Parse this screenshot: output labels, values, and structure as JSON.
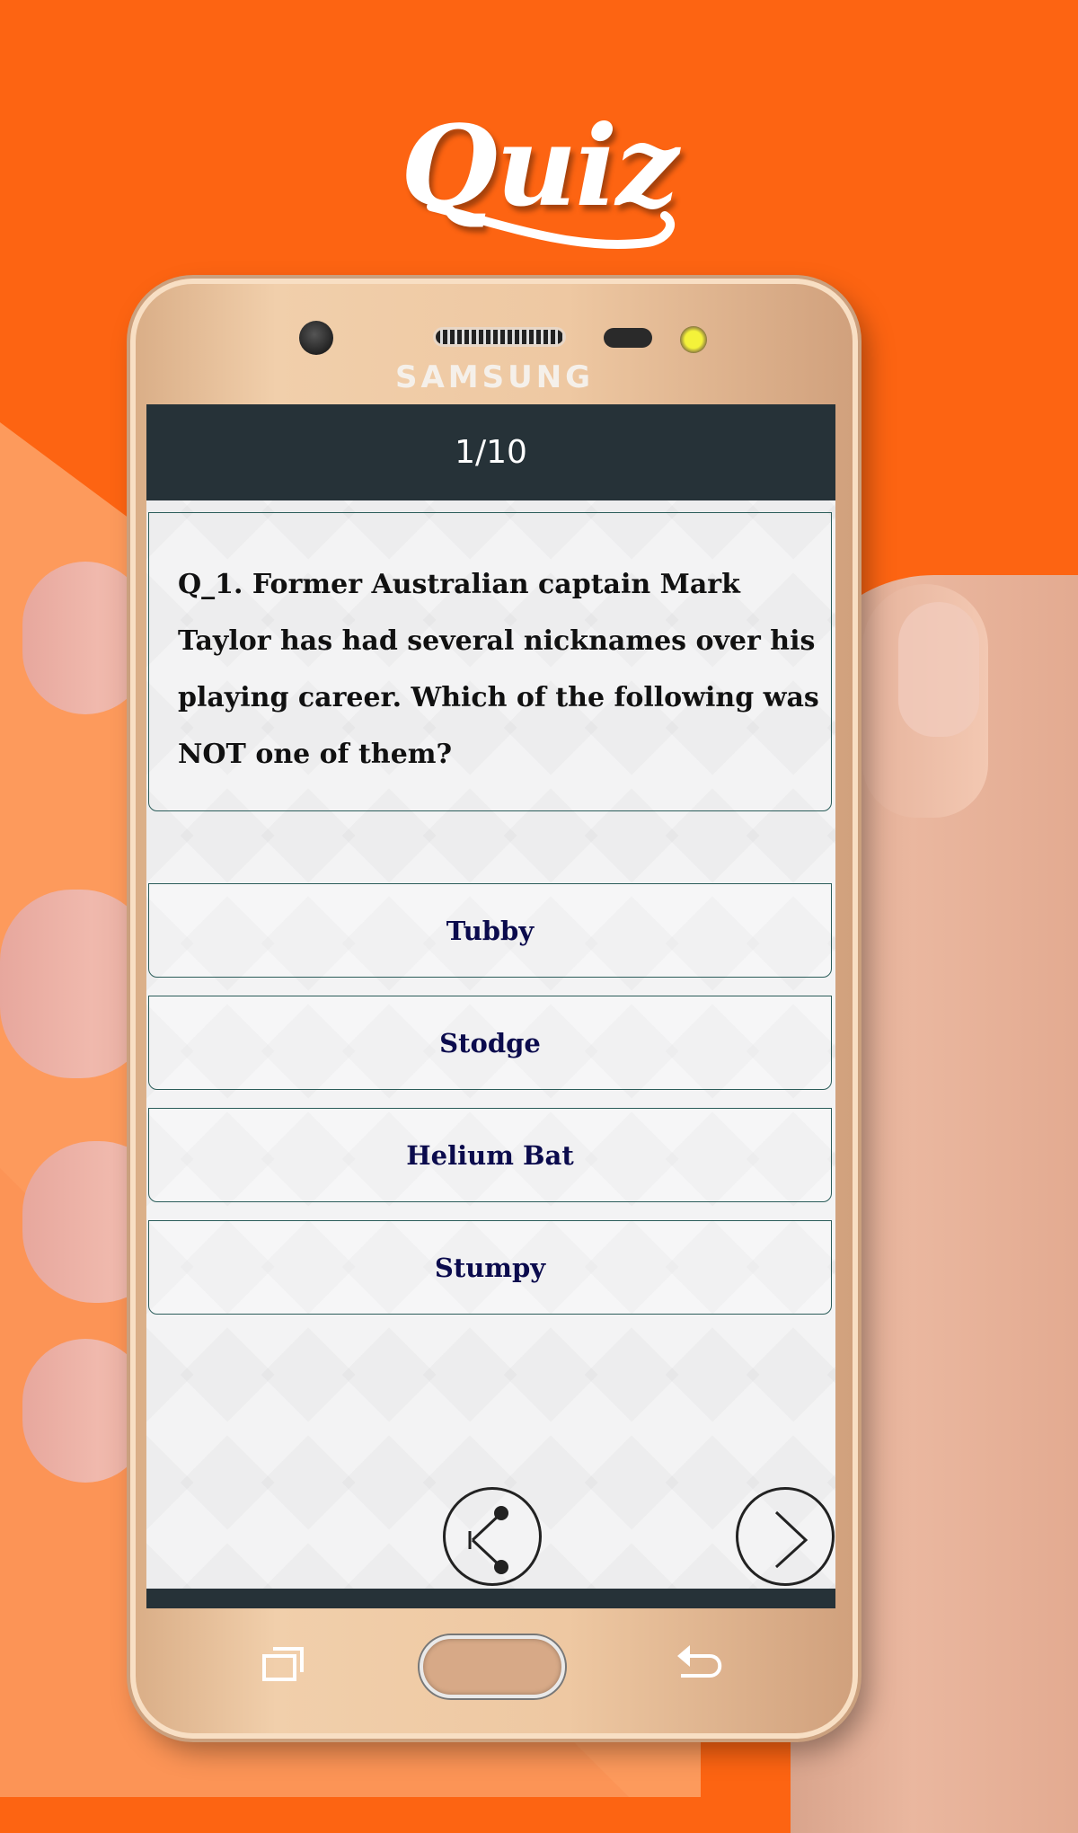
{
  "branding": {
    "logo_text": "Quiz",
    "device_brand": "SAMSUNG"
  },
  "colors": {
    "background_orange": "#fd6412",
    "header_bar": "#263238",
    "answer_text": "#0b0b4d",
    "border": "#2b5d5a"
  },
  "quiz": {
    "progress": "1/10",
    "question": "Q_1.  Former Australian captain Mark Taylor has had several nicknames over his playing career. Which of the following was NOT one of them?",
    "answers": [
      {
        "label": "Tubby"
      },
      {
        "label": "Stodge"
      },
      {
        "label": "Helium Bat"
      },
      {
        "label": "Stumpy"
      }
    ]
  },
  "navigation": {
    "share_icon": "share-icon",
    "next_icon": "chevron-right-icon"
  },
  "device_keys": {
    "recent_icon": "recent-apps-icon",
    "home": "home-button",
    "back_icon": "back-icon"
  }
}
